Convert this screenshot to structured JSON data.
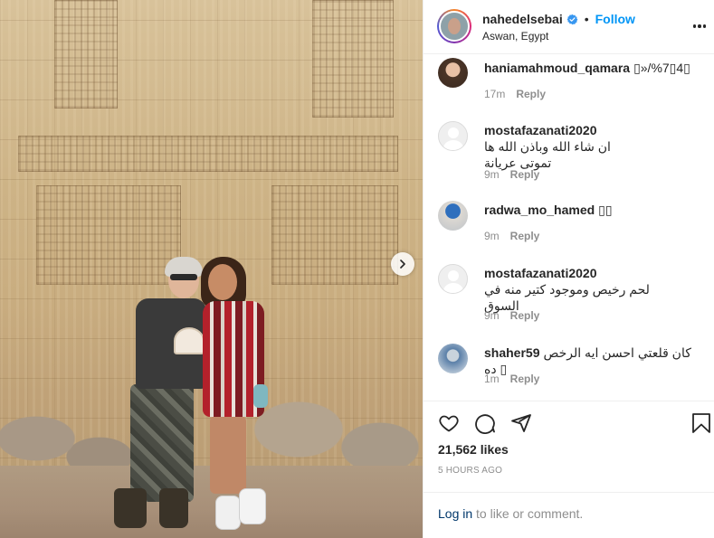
{
  "post": {
    "username": "nahedelsebai",
    "follow_label": "Follow",
    "separator": "•",
    "location": "Aswan, Egypt",
    "photo_alt": "Two women standing in front of an ancient Egyptian temple wall with hieroglyphic carvings"
  },
  "icons": {
    "verified": "verified-badge-icon",
    "more": "more-options-icon",
    "next": "chevron-right-icon",
    "like": "heart-icon",
    "comment": "comment-icon",
    "share": "paper-plane-icon",
    "save": "bookmark-icon"
  },
  "colors": {
    "accent": "#0095f6",
    "verified": "#3897f0",
    "muted": "#8e8e8e",
    "text": "#262626",
    "link": "#00376b"
  },
  "comments": [
    {
      "user": "haniamahmoud_qamara",
      "text": "▯»/%7▯4▯",
      "time": "17m",
      "reply": "Reply"
    },
    {
      "user": "mostafazanati2020",
      "text": "ان شاء الله وباذن الله ها تموتى عريانة",
      "time": "9m",
      "reply": "Reply"
    },
    {
      "user": "radwa_mo_hamed",
      "text": "▯▯",
      "time": "9m",
      "reply": "Reply"
    },
    {
      "user": "mostafazanati2020",
      "text": "لحم رخيص وموجود كتير منه في السوق",
      "time": "9m",
      "reply": "Reply"
    },
    {
      "user": "shaher59",
      "text": "كان قلعتي احسن ايه الرخص ده ▯",
      "time": "1m",
      "reply": "Reply"
    }
  ],
  "stats": {
    "likes": "21,562 likes",
    "posted": "5 HOURS AGO"
  },
  "login": {
    "link": "Log in",
    "rest": " to like or comment."
  }
}
